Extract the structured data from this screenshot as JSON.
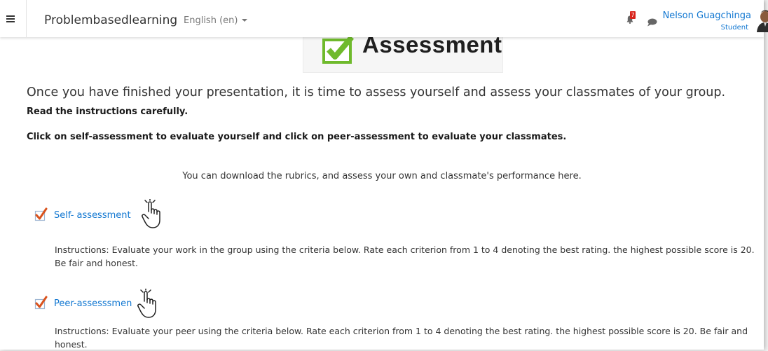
{
  "navbar": {
    "site_name": "Problembasedlearning",
    "language": "English (en)",
    "notification_count": "7",
    "user_name": "Nelson Guagchinga",
    "user_role": "Student"
  },
  "banner": {
    "title": "Assessment"
  },
  "content": {
    "intro": "Once you have finished your presentation, it is time to assess yourself and assess your classmates of your group.",
    "read_instructions": "Read the instructions carefully.",
    "click_instructions": "Click on self-assessment to evaluate yourself and click on peer-assessment to evaluate your classmates.",
    "download_text": "You can download the rubrics, and assess your own and classmate's performance here."
  },
  "activities": [
    {
      "label": "Self- assessment",
      "instructions": "Instructions: Evaluate your work in the group using the criteria below. Rate each criterion from 1 to 4 denoting the best rating. the highest possible score is 20. Be fair and honest."
    },
    {
      "label": "Peer-assesssmen",
      "instructions": "Instructions: Evaluate your peer using the criteria below. Rate each criterion from 1 to 4 denoting the best rating. the highest possible score is 20. Be fair and honest."
    }
  ],
  "colors": {
    "link": "#1177d1",
    "badge": "#d9241c",
    "check_green": "#6fba2c"
  },
  "icons": [
    "hamburger-icon",
    "bell-icon",
    "chat-icon",
    "avatar",
    "checkbox-icon",
    "hand-pointer-icon"
  ]
}
